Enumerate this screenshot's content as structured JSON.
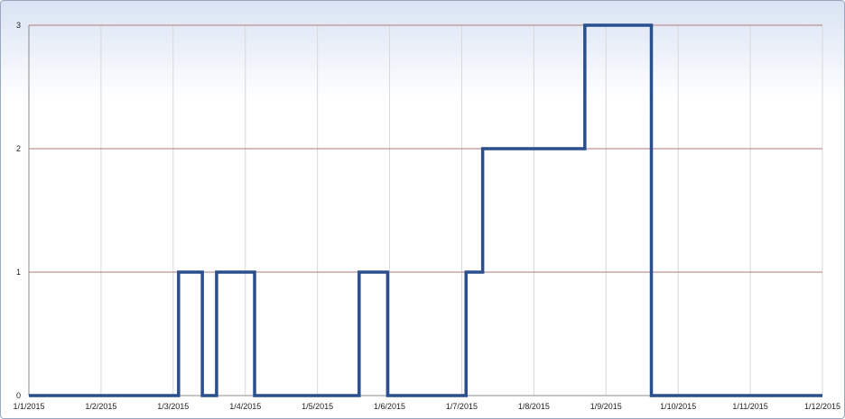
{
  "chart_data": {
    "type": "line",
    "step": true,
    "title": "",
    "xlabel": "",
    "ylabel": "",
    "x_ticks": [
      "1/1/2015",
      "1/2/2015",
      "1/3/2015",
      "1/4/2015",
      "1/5/2015",
      "1/6/2015",
      "1/7/2015",
      "1/8/2015",
      "1/9/2015",
      "1/10/2015",
      "1/11/2015",
      "1/12/2015"
    ],
    "y_ticks": [
      "0",
      "1",
      "2",
      "3"
    ],
    "ylim": [
      0,
      3
    ],
    "xlim": [
      "2015-01-01",
      "2015-12-01"
    ],
    "series": [
      {
        "color": "#2a4f8f",
        "points": [
          [
            "2015-01-01",
            0
          ],
          [
            "2015-03-05",
            1
          ],
          [
            "2015-03-15",
            0
          ],
          [
            "2015-03-21",
            1
          ],
          [
            "2015-04-06",
            0
          ],
          [
            "2015-05-20",
            1
          ],
          [
            "2015-06-01",
            0
          ],
          [
            "2015-07-04",
            1
          ],
          [
            "2015-07-11",
            2
          ],
          [
            "2015-08-23",
            3
          ],
          [
            "2015-09-20",
            0
          ],
          [
            "2015-12-01",
            0
          ]
        ]
      }
    ],
    "grid": {
      "x": true,
      "y": true,
      "y_color": "#b07a7a",
      "x_color": "#d8d8d8"
    }
  }
}
